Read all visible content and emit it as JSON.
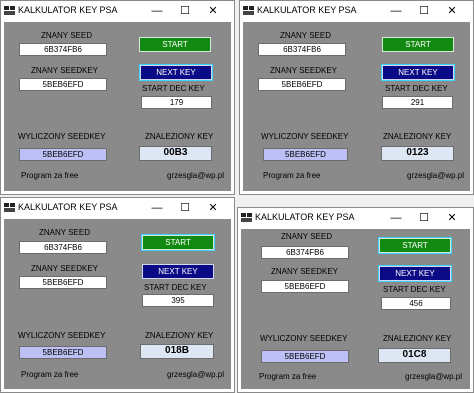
{
  "window": {
    "title": "KALKULATOR KEY PSA",
    "minimize": "—",
    "maximize": "☐",
    "close": "✕"
  },
  "labels": {
    "znany_seed": "ZNANY SEED",
    "znany_seedkey": "ZNANY SEEDKEY",
    "start_dec_key": "START DEC KEY",
    "wyliczony_seedkey": "WYLICZONY SEEDKEY",
    "znaleziony_key": "ZNALEZIONY KEY",
    "footer_left": "Program za free",
    "footer_right": "grzesgla@wp.pl"
  },
  "buttons": {
    "start": "START",
    "next_key": "NEXT KEY"
  },
  "instances": [
    {
      "seed": "6B374FB6",
      "seedkey": "5BEB6EFD",
      "start_dec": "179",
      "computed_seedkey": "5BEB6EFD",
      "found_key": "00B3"
    },
    {
      "seed": "6B374FB6",
      "seedkey": "5BEB6EFD",
      "start_dec": "291",
      "computed_seedkey": "5BEB6EFD",
      "found_key": "0123"
    },
    {
      "seed": "6B374FB6",
      "seedkey": "5BEB6EFD",
      "start_dec": "395",
      "computed_seedkey": "5BEB6EFD",
      "found_key": "018B"
    },
    {
      "seed": "6B374FB6",
      "seedkey": "5BEB6EFD",
      "start_dec": "456",
      "computed_seedkey": "5BEB6EFD",
      "found_key": "01C8"
    }
  ],
  "colors": {
    "panel": "#8a8a8a",
    "start_button": "#128a12",
    "next_button": "#0a0a86",
    "computed_field": "#bcc0f4",
    "key_field": "#dde6f3"
  },
  "icons": {
    "app": "app-icon",
    "minimize": "minimize-icon",
    "maximize": "maximize-icon",
    "close": "close-icon"
  }
}
